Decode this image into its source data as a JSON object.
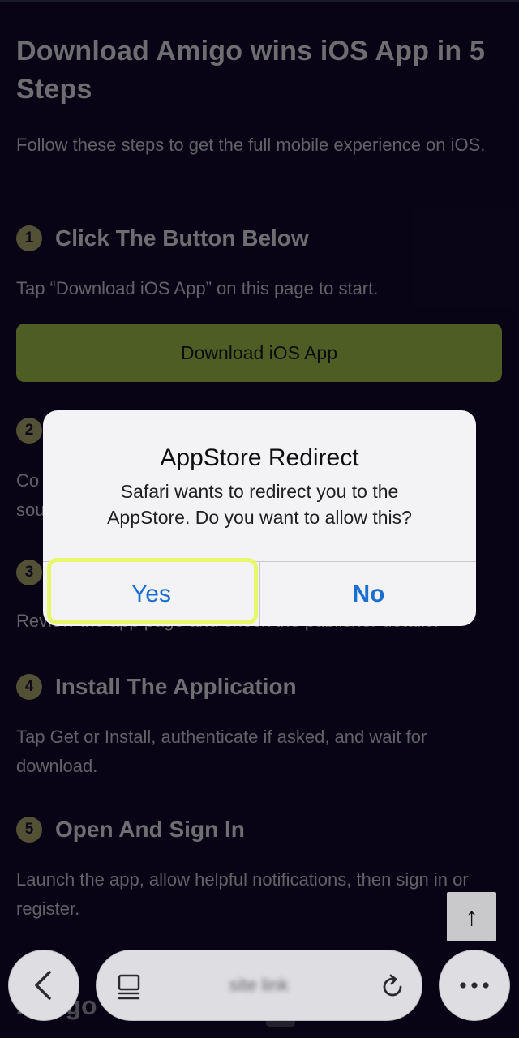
{
  "page": {
    "title": "Download Amigo wins iOS App in 5 Steps",
    "intro": "Follow these steps to get the full mobile experience on iOS."
  },
  "steps": [
    {
      "num": "1",
      "title": "Click The Button Below",
      "desc": "Tap “Download iOS App” on this page to start."
    },
    {
      "num": "2",
      "title": "",
      "desc_partial": "Co",
      "desc_partial2": "sou"
    },
    {
      "num": "3",
      "title": "",
      "desc": "Review the app page and check the publisher details."
    },
    {
      "num": "4",
      "title": "Install The Application",
      "desc": "Tap Get or Install, authenticate if asked, and wait for download."
    },
    {
      "num": "5",
      "title": "Open And Sign In",
      "desc": "Launch the app, allow helpful notifications, then sign in or register."
    }
  ],
  "download_button": {
    "label": "Download iOS App"
  },
  "dialog": {
    "title": "AppStore Redirect",
    "message_line1": "Safari wants to redirect you to the",
    "message_line2": "AppStore.  Do you want to allow this?",
    "yes_label": "Yes",
    "no_label": "No"
  },
  "footer_peek": "Amigo",
  "browser": {
    "url_text": "site link",
    "scroll_top_glyph": "↑",
    "icons": [
      "chevron-left-icon",
      "tabs-icon",
      "reload-icon",
      "more-icon"
    ]
  },
  "colors": {
    "background": "#0f0726",
    "accent_button": "#87a03d",
    "dialog_button": "#1a6fd0",
    "highlight": "#e6f76b"
  }
}
